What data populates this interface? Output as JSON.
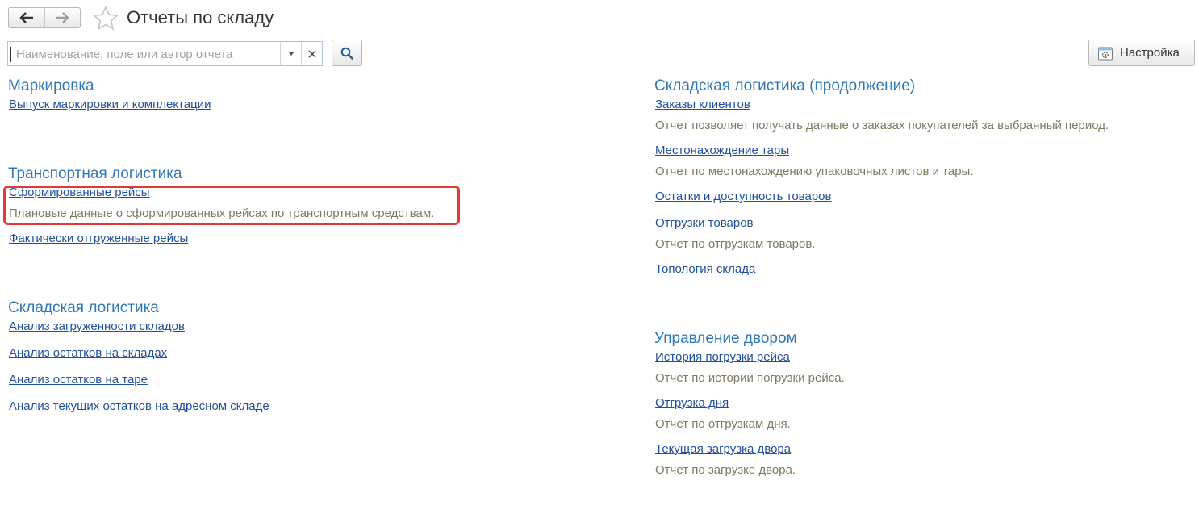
{
  "header": {
    "title": "Отчеты по складу",
    "back_icon": "arrow-left-icon",
    "forward_icon": "arrow-right-icon",
    "favorite_icon": "star-outline-icon"
  },
  "search": {
    "placeholder": "Наименование, поле или автор отчета",
    "value": ""
  },
  "toolbar": {
    "settings_label": "Настройка"
  },
  "colors": {
    "section_title": "#2f77b5",
    "link": "#214f9c",
    "description": "#7f7a5f",
    "highlight": "#e03a37"
  },
  "left": {
    "marking": {
      "title": "Маркировка",
      "items": [
        {
          "label": "Выпуск маркировки и комплектации"
        }
      ]
    },
    "transport": {
      "title": "Транспортная логистика",
      "items": [
        {
          "label": "Сформированные рейсы",
          "desc": "Плановые данные о сформированных рейсах по транспортным средствам."
        },
        {
          "label": "Фактически отгруженные рейсы"
        }
      ]
    },
    "warehouse": {
      "title": "Складская логистика",
      "items": [
        {
          "label": "Анализ загруженности складов"
        },
        {
          "label": "Анализ остатков на складах"
        },
        {
          "label": "Анализ остатков на таре"
        },
        {
          "label": "Анализ текущих остатков на адресном складе"
        }
      ]
    }
  },
  "right": {
    "warehouse_cont": {
      "title": "Складская логистика (продолжение)",
      "items": [
        {
          "label": "Заказы клиентов",
          "desc": "Отчет позволяет получать данные о заказах покупателей за выбранный период."
        },
        {
          "label": "Местонахождение тары",
          "desc": "Отчет по местонахождению упаковочных листов и тары."
        },
        {
          "label": "Остатки и доступность товаров"
        },
        {
          "label": "Отгрузки товаров",
          "desc": "Отчет по отгрузкам товаров."
        },
        {
          "label": "Топология склада"
        }
      ]
    },
    "yard": {
      "title": "Управление двором",
      "items": [
        {
          "label": "История погрузки рейса",
          "desc": "Отчет по истории погрузки рейса."
        },
        {
          "label": "Отгрузка дня",
          "desc": "Отчет по отгрузкам дня."
        },
        {
          "label": "Текущая загрузка двора",
          "desc": "Отчет по загрузке двора."
        }
      ]
    }
  }
}
